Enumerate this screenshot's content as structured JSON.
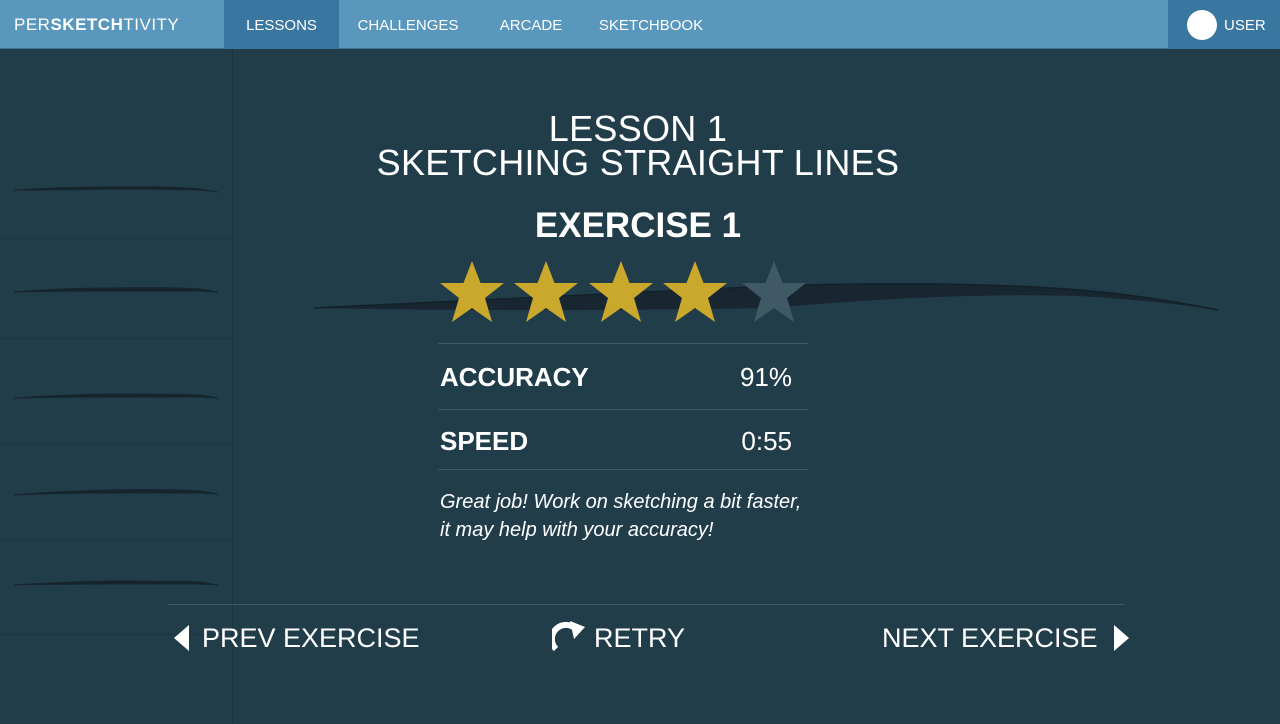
{
  "brand": {
    "prefix": "PER",
    "bold": "SKETCH",
    "suffix": "TIVITY"
  },
  "nav": {
    "items": [
      {
        "label": "LESSONS",
        "active": true
      },
      {
        "label": "CHALLENGES",
        "active": false
      },
      {
        "label": "ARCADE",
        "active": false
      },
      {
        "label": "SKETCHBOOK",
        "active": false
      }
    ],
    "user_label": "USER"
  },
  "lesson": {
    "number_line": "LESSON 1",
    "title_line": "SKETCHING STRAIGHT LINES",
    "exercise": "EXERCISE 1"
  },
  "rating": {
    "stars_earned": 4,
    "stars_total": 5
  },
  "stats": {
    "accuracy_label": "ACCURACY",
    "accuracy_value": "91%",
    "speed_label": "SPEED",
    "speed_value": "0:55"
  },
  "feedback": "Great job!  Work on sketching a bit faster, it may help with your accuracy!",
  "actions": {
    "prev": "PREV EXERCISE",
    "retry": "RETRY",
    "next": "NEXT EXERCISE"
  },
  "colors": {
    "background": "#223d4a",
    "topbar": "#5a97bc",
    "topbar_active": "#3a77a0",
    "star_filled": "#c9a82c",
    "star_empty": "#3f5a66",
    "stroke": "#16242e"
  },
  "icons": {
    "prev": "caret-left-icon",
    "retry": "redo-arrow-icon",
    "next": "caret-right-icon",
    "star": "star-icon"
  }
}
